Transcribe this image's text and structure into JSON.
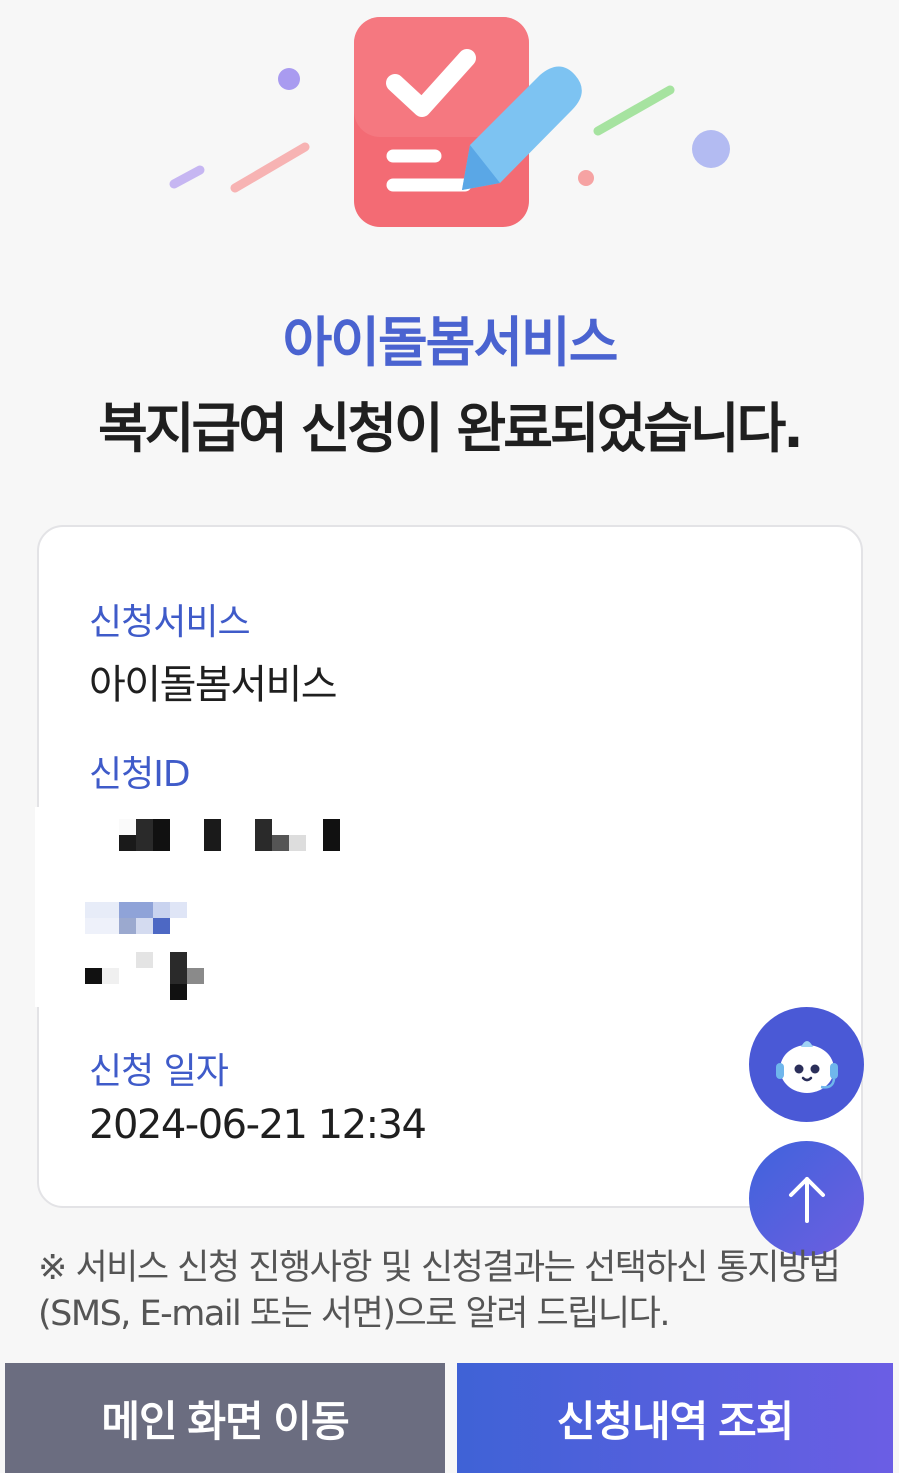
{
  "hero": {
    "icon": "checklist-pencil-illustration"
  },
  "header": {
    "service_name": "아이돌봄서비스",
    "complete_message": "복지급여 신청이 완료되었습니다."
  },
  "details": {
    "service_label": "신청서비스",
    "service_value": "아이돌봄서비스",
    "id_label": "신청ID",
    "id_value_note": "redacted",
    "date_label": "신청 일자",
    "date_value": "2024-06-21 12:34"
  },
  "floating": {
    "chatbot_icon": "chatbot-icon",
    "scroll_top_icon": "arrow-up-icon"
  },
  "notice": {
    "text": "※ 서비스 신청 진행사항 및 신청결과는 선택하신 통지방법(SMS, E-mail 또는 서면)으로 알려 드립니다."
  },
  "buttons": {
    "main_label": "메인 화면 이동",
    "history_label": "신청내역 조회"
  },
  "colors": {
    "accent": "#4a63d0",
    "button_gray": "#6b6d80",
    "button_blue_start": "#3f62d6",
    "button_blue_end": "#6b5ee4"
  }
}
